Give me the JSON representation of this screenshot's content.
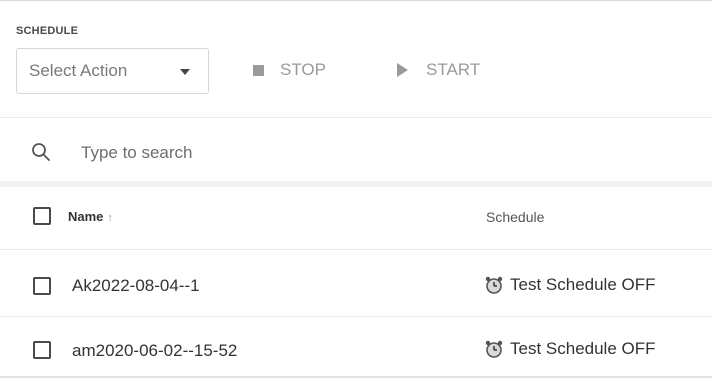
{
  "section": {
    "title": "SCHEDULE"
  },
  "toolbar": {
    "select_action": "Select Action",
    "stop_label": "STOP",
    "start_label": "START"
  },
  "search": {
    "placeholder": "Type to search"
  },
  "table": {
    "columns": {
      "name": "Name",
      "sort_indicator": "↑",
      "schedule": "Schedule"
    },
    "rows": [
      {
        "name": "Ak2022-08-04--1",
        "schedule": "Test Schedule OFF",
        "schedule_icon": "alarm-clock-icon"
      },
      {
        "name": "am2020-06-02--15-52",
        "schedule": "Test Schedule OFF",
        "schedule_icon": "alarm-clock-icon"
      }
    ]
  },
  "colors": {
    "inactive_action": "#9a9a9a",
    "divider": "#ececec"
  }
}
